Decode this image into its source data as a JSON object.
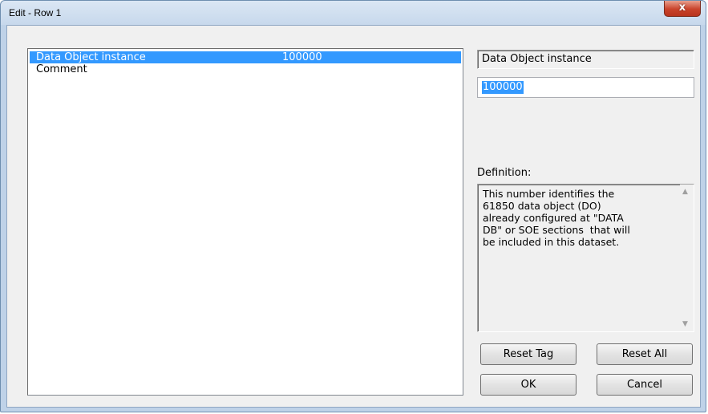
{
  "window": {
    "title": "Edit - Row 1",
    "close_glyph": "x"
  },
  "list": {
    "rows": [
      {
        "name": "Data Object instance",
        "value": "100000",
        "selected": true
      },
      {
        "name": "Comment",
        "value": "",
        "selected": false
      }
    ]
  },
  "field": {
    "name": "Data Object instance",
    "value": "100000"
  },
  "definition": {
    "label": "Definition:",
    "text": "This number identifies the\n61850 data object (DO)\nalready configured at \"DATA\nDB\" or SOE sections  that will\nbe included in this dataset.",
    "scroll_up": "▲",
    "scroll_down": "▼"
  },
  "buttons": {
    "reset_tag": "Reset Tag",
    "reset_all": "Reset All",
    "ok": "OK",
    "cancel": "Cancel"
  }
}
